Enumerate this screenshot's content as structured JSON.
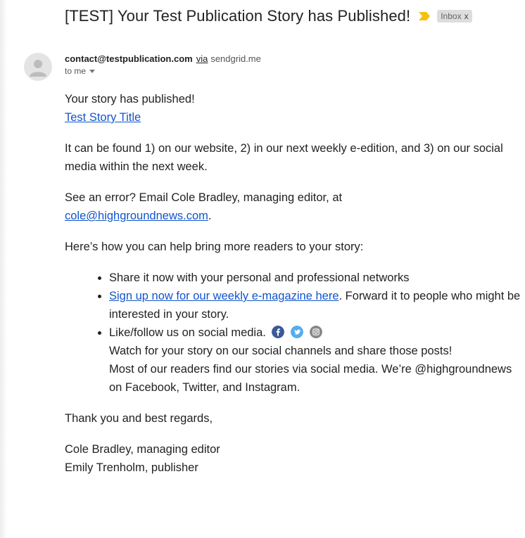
{
  "email": {
    "subject": "[TEST] Your Test Publication Story has Published!",
    "label": "Inbox",
    "label_close": "x",
    "sender": {
      "email": "contact@testpublication.com",
      "via_label": "via",
      "via_domain": "sendgrid.me",
      "to_label": "to me"
    }
  },
  "body": {
    "intro": "Your story has published!",
    "story_link": "Test Story Title",
    "found_text": "It can be found 1) on our website, 2) in our next weekly e-edition, and 3) on our social media within the next week.",
    "error_text": "See an error? Email Cole Bradley, managing editor, at",
    "error_email": "cole@highgroundnews.com",
    "error_period": ".",
    "help_heading": "Here’s how you can help bring more readers to your story:",
    "bullet1": "Share it now with your personal and professional networks",
    "bullet2_link": "Sign up now for our weekly e-magazine here",
    "bullet2_text": ". Forward it to people who might be interested in your story.",
    "bullet3_main": "Like/follow us on social media.",
    "bullet3_line2": "Watch for your story on our social channels and share those posts!",
    "bullet3_line3": "Most of our readers find our stories via social media. We’re @highgroundnews on Facebook, Twitter, and Instagram.",
    "closing": "Thank you and best regards,",
    "signature1": "Cole Bradley, managing editor",
    "signature2": "Emily Trenholm, publisher"
  },
  "icons": {
    "facebook": "facebook-icon",
    "twitter": "twitter-icon",
    "instagram": "instagram-icon",
    "facebook_color": "#3b5998",
    "twitter_color": "#55acee",
    "instagram_color": "#888888",
    "importance_color": "#f4c20d",
    "link_color": "#1155cc"
  }
}
